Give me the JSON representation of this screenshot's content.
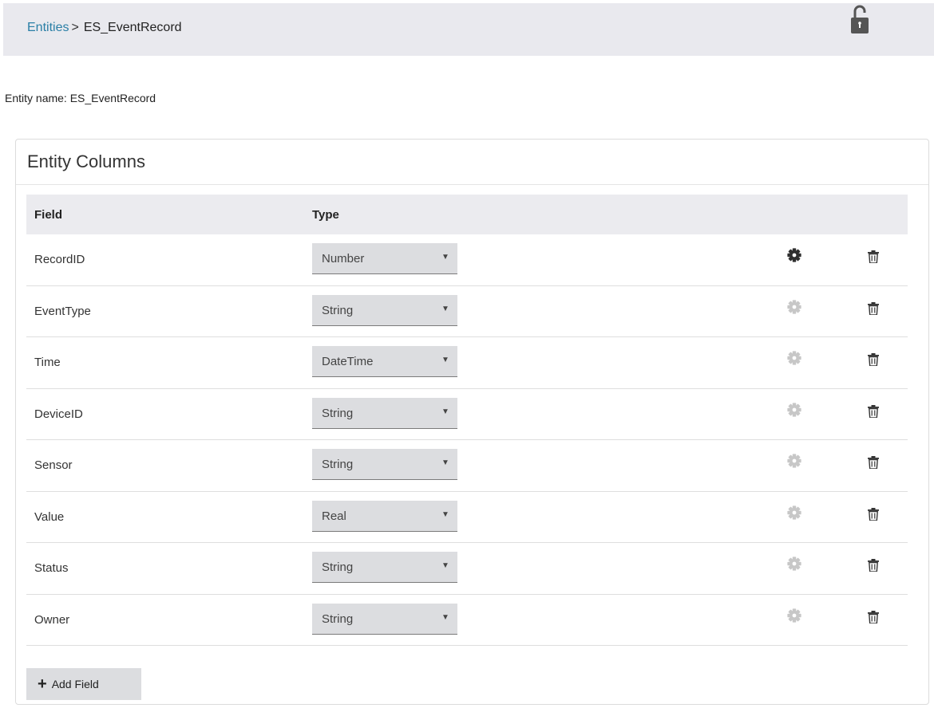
{
  "breadcrumb": {
    "parent": "Entities",
    "separator": ">",
    "current": "ES_EventRecord"
  },
  "header_icon": "unlocked-padlock-icon",
  "entity_name_label": "Entity name: ES_EventRecord",
  "panel": {
    "title": "Entity Columns",
    "headers": {
      "field": "Field",
      "type": "Type"
    },
    "rows": [
      {
        "field": "RecordID",
        "type": "Number",
        "gear_active": true
      },
      {
        "field": "EventType",
        "type": "String",
        "gear_active": false
      },
      {
        "field": "Time",
        "type": "DateTime",
        "gear_active": false
      },
      {
        "field": "DeviceID",
        "type": "String",
        "gear_active": false
      },
      {
        "field": "Sensor",
        "type": "String",
        "gear_active": false
      },
      {
        "field": "Value",
        "type": "Real",
        "gear_active": false
      },
      {
        "field": "Status",
        "type": "String",
        "gear_active": false
      },
      {
        "field": "Owner",
        "type": "String",
        "gear_active": false
      }
    ],
    "add_button": {
      "icon": "+",
      "label": "Add Field"
    }
  },
  "colors": {
    "link": "#2a7fa6",
    "topbar": "#e9e9ee",
    "gear_active": "#2e2e2e",
    "gear_inactive": "#c7c7c7",
    "select_bg": "#dcdde0"
  }
}
